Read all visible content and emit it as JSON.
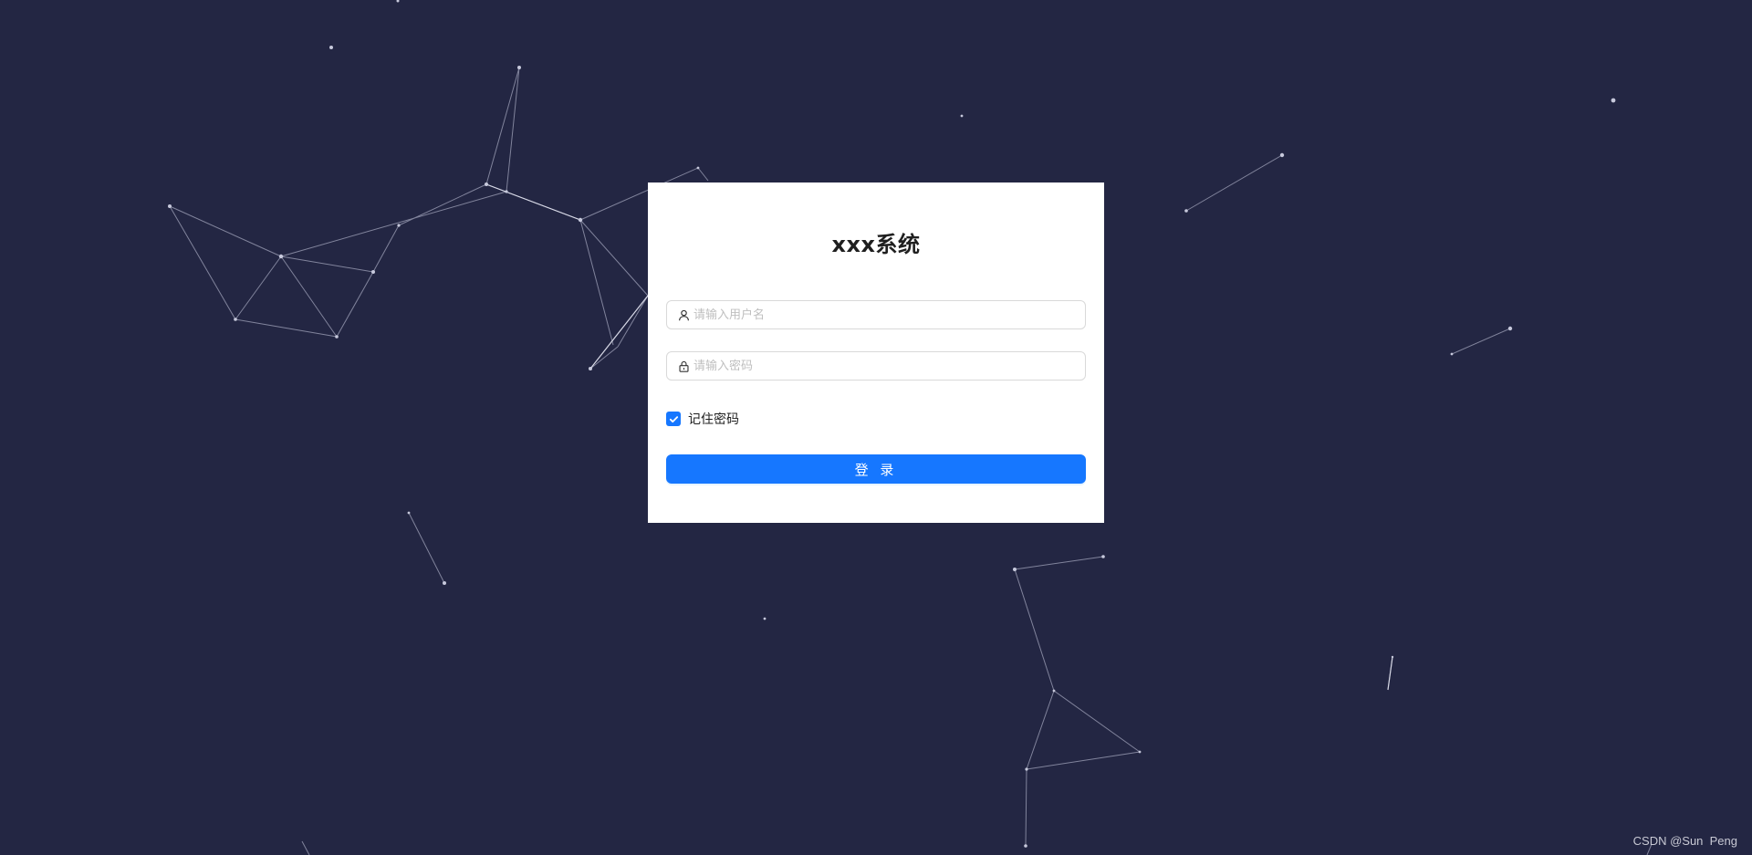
{
  "login": {
    "title": "xxx系统",
    "username_placeholder": "请输入用户名",
    "password_placeholder": "请输入密码",
    "remember_label": "记住密码",
    "remember_checked": true,
    "submit_label": "登 录"
  },
  "watermark": "CSDN @Sun  Peng",
  "icons": {
    "username": "user-icon",
    "password": "lock-icon",
    "checkbox": "check-icon"
  },
  "colors": {
    "background": "#232643",
    "accent": "#1677ff",
    "card": "#ffffff"
  }
}
